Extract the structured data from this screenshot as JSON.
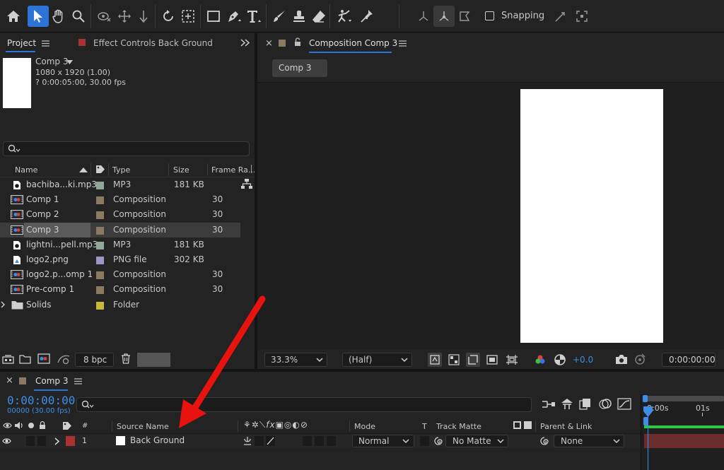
{
  "toolbar": {
    "tools": [
      "home-icon",
      "selection-tool-icon",
      "hand-tool-icon",
      "zoom-tool-icon",
      "orbit-camera-icon",
      "pan-camera-icon",
      "dolly-camera-icon",
      "rotate-tool-icon",
      "pan-behind-icon",
      "rectangle-tool-icon",
      "pen-tool-icon",
      "type-tool-icon",
      "brush-tool-icon",
      "clone-stamp-icon",
      "eraser-icon",
      "roto-brush-icon",
      "puppet-pin-icon"
    ],
    "snapping_label": "Snapping"
  },
  "project_panel": {
    "tab_project": "Project",
    "tab_effect_controls": "Effect Controls Back Ground",
    "comp_name": "Comp 3",
    "comp_dimensions": "1080 x 1920 (1.00)",
    "comp_duration": "? 0:00:05:00, 30.00 fps",
    "search_placeholder": "",
    "columns": {
      "name": "Name",
      "type": "Type",
      "size": "Size",
      "frame_rate": "Frame Ra..."
    },
    "items": [
      {
        "name": "bachiba...ki.mp3",
        "type": "MP3",
        "size": "181 KB",
        "fps": "",
        "color": "#8fa89a",
        "icon": "audio-file-icon"
      },
      {
        "name": "Comp 1",
        "type": "Composition",
        "size": "",
        "fps": "30",
        "color": "#8a7a62",
        "icon": "composition-icon"
      },
      {
        "name": "Comp 2",
        "type": "Composition",
        "size": "",
        "fps": "30",
        "color": "#8a7a62",
        "icon": "composition-icon"
      },
      {
        "name": "Comp 3",
        "type": "Composition",
        "size": "",
        "fps": "30",
        "color": "#8a7a62",
        "icon": "composition-icon"
      },
      {
        "name": "lightni...pell.mp3",
        "type": "MP3",
        "size": "181 KB",
        "fps": "",
        "color": "#8fa89a",
        "icon": "audio-file-icon"
      },
      {
        "name": "logo2.png",
        "type": "PNG file",
        "size": "302 KB",
        "fps": "",
        "color": "#9d97c8",
        "icon": "image-file-icon"
      },
      {
        "name": "logo2.p...omp 1",
        "type": "Composition",
        "size": "",
        "fps": "30",
        "color": "#8a7a62",
        "icon": "composition-icon"
      },
      {
        "name": "Pre-comp 1",
        "type": "Composition",
        "size": "",
        "fps": "30",
        "color": "#8a7a62",
        "icon": "composition-icon"
      },
      {
        "name": "Solids",
        "type": "Folder",
        "size": "",
        "fps": "",
        "color": "#c9b73a",
        "icon": "folder-icon"
      }
    ],
    "bpc_label": "8 bpc"
  },
  "composition_panel": {
    "tab_title": "Composition Comp 3",
    "breadcrumb": "Comp 3",
    "zoom": "33.3%",
    "resolution": "(Half)",
    "exposure": "+0.0",
    "timecode": "0:00:00:00"
  },
  "timeline": {
    "tab_title": "Comp 3",
    "current_time": "0:00:00:00",
    "frame_info": "00000 (30.00 fps)",
    "search_placeholder": "",
    "columns": {
      "number": "#",
      "source_name": "Source Name",
      "mode": "Mode",
      "t": "T",
      "track_matte": "Track Matte",
      "parent": "Parent & Link"
    },
    "ruler": {
      "start": "0:00s",
      "second": "01s"
    },
    "layers": [
      {
        "number": "1",
        "name": "Back Ground",
        "mode": "Normal",
        "track_matte": "No Matte",
        "parent": "None",
        "label_color": "#a83232"
      }
    ]
  },
  "colors": {
    "accent": "#2d74d8",
    "timecode": "#3e8ee8",
    "annotation_arrow": "#e8120e",
    "layer_bar": "#6b2c2c",
    "work_area": "#2ec742"
  }
}
